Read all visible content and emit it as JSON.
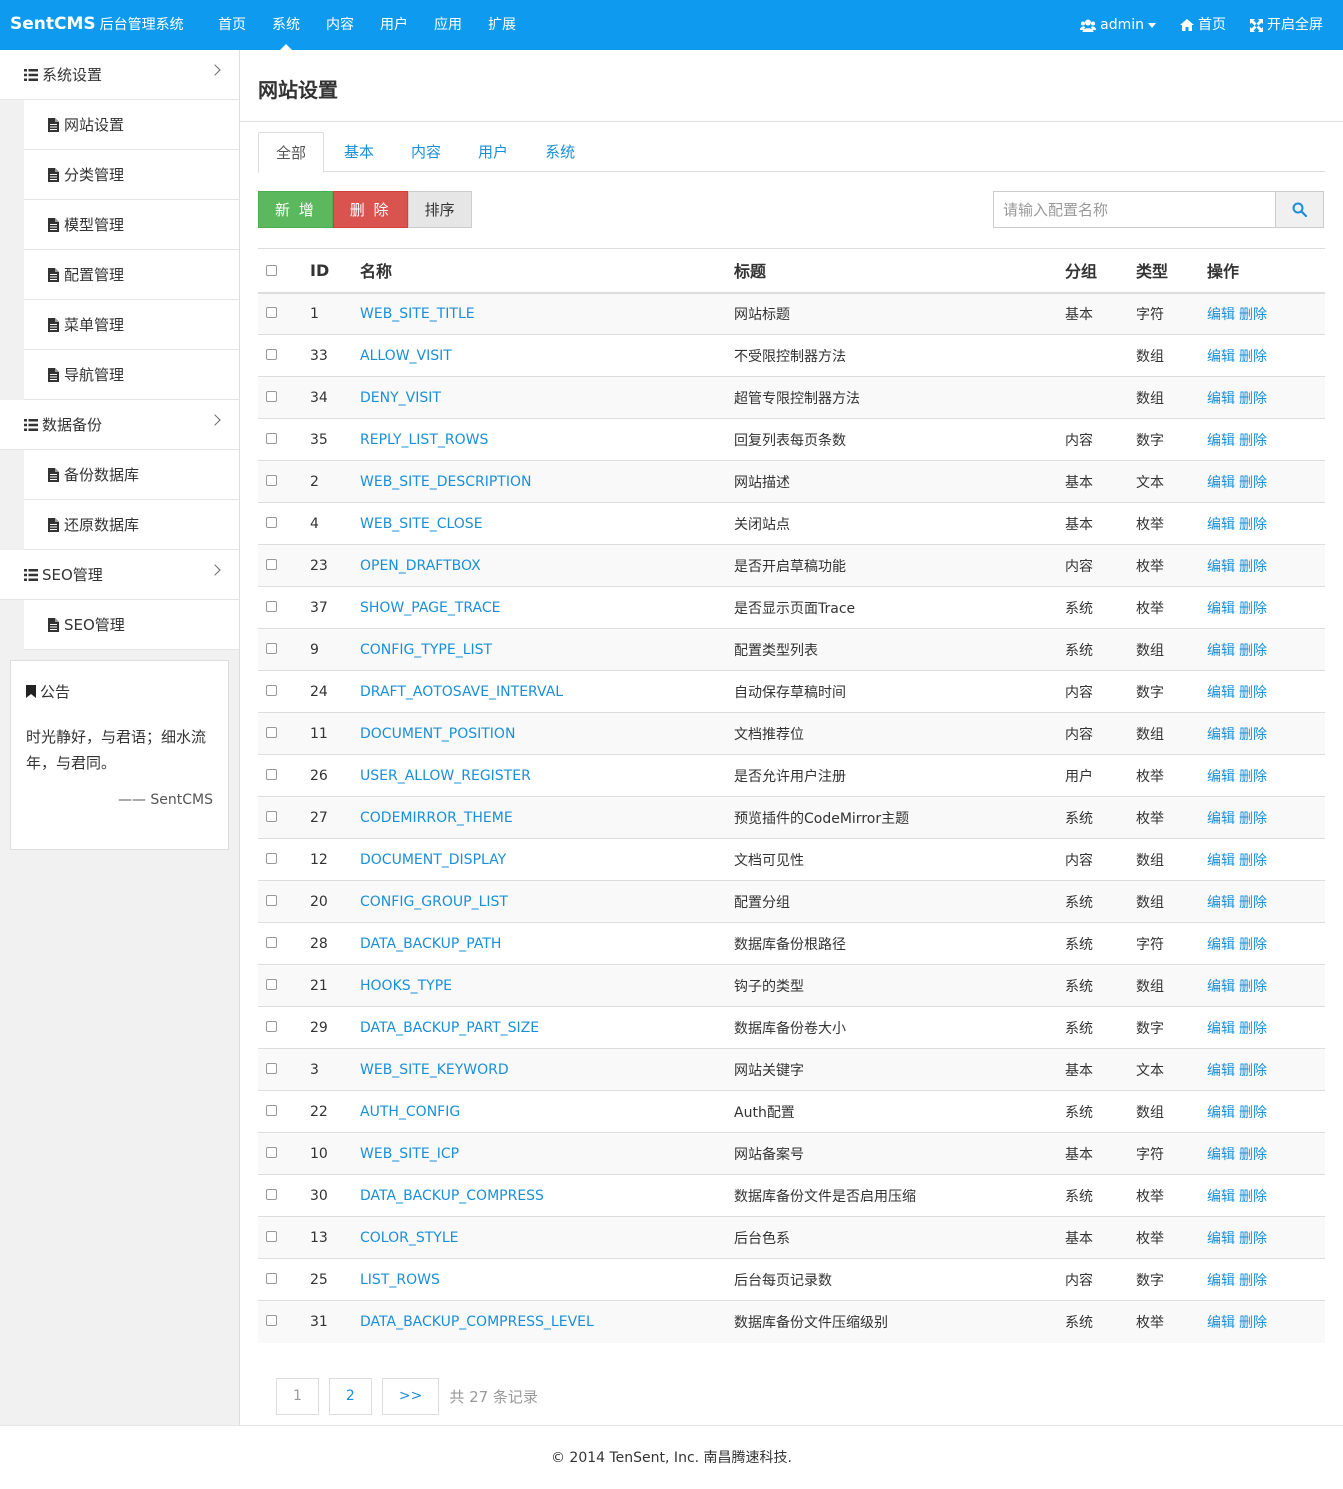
{
  "header": {
    "brand": "SentCMS",
    "brand_sub": "后台管理系统",
    "nav": [
      "首页",
      "系统",
      "内容",
      "用户",
      "应用",
      "扩展"
    ],
    "active_nav": 1,
    "user": "admin",
    "home": "首页",
    "fullscreen": "开启全屏"
  },
  "sidebar": {
    "group1": "系统设置",
    "group1_items": [
      "网站设置",
      "分类管理",
      "模型管理",
      "配置管理",
      "菜单管理",
      "导航管理"
    ],
    "group2": "数据备份",
    "group2_items": [
      "备份数据库",
      "还原数据库"
    ],
    "group3": "SEO管理",
    "group3_items": [
      "SEO管理"
    ],
    "notice_title": "公告",
    "notice_text": "时光静好，与君语；细水流年，与君同。",
    "notice_sign": "—— SentCMS"
  },
  "main": {
    "title": "网站设置",
    "tabs": [
      "全部",
      "基本",
      "内容",
      "用户",
      "系统"
    ],
    "btn_add": "新 增",
    "btn_delete": "删 除",
    "btn_sort": "排序",
    "search_placeholder": "请输入配置名称",
    "columns": [
      "ID",
      "名称",
      "标题",
      "分组",
      "类型",
      "操作"
    ],
    "edit_label": "编辑",
    "delete_label": "删除",
    "rows": [
      {
        "id": "1",
        "name": "WEB_SITE_TITLE",
        "title": "网站标题",
        "group": "基本",
        "type": "字符"
      },
      {
        "id": "33",
        "name": "ALLOW_VISIT",
        "title": "不受限控制器方法",
        "group": "",
        "type": "数组"
      },
      {
        "id": "34",
        "name": "DENY_VISIT",
        "title": "超管专限控制器方法",
        "group": "",
        "type": "数组"
      },
      {
        "id": "35",
        "name": "REPLY_LIST_ROWS",
        "title": "回复列表每页条数",
        "group": "内容",
        "type": "数字"
      },
      {
        "id": "2",
        "name": "WEB_SITE_DESCRIPTION",
        "title": "网站描述",
        "group": "基本",
        "type": "文本"
      },
      {
        "id": "4",
        "name": "WEB_SITE_CLOSE",
        "title": "关闭站点",
        "group": "基本",
        "type": "枚举"
      },
      {
        "id": "23",
        "name": "OPEN_DRAFTBOX",
        "title": "是否开启草稿功能",
        "group": "内容",
        "type": "枚举"
      },
      {
        "id": "37",
        "name": "SHOW_PAGE_TRACE",
        "title": "是否显示页面Trace",
        "group": "系统",
        "type": "枚举"
      },
      {
        "id": "9",
        "name": "CONFIG_TYPE_LIST",
        "title": "配置类型列表",
        "group": "系统",
        "type": "数组"
      },
      {
        "id": "24",
        "name": "DRAFT_AOTOSAVE_INTERVAL",
        "title": "自动保存草稿时间",
        "group": "内容",
        "type": "数字"
      },
      {
        "id": "11",
        "name": "DOCUMENT_POSITION",
        "title": "文档推荐位",
        "group": "内容",
        "type": "数组"
      },
      {
        "id": "26",
        "name": "USER_ALLOW_REGISTER",
        "title": "是否允许用户注册",
        "group": "用户",
        "type": "枚举"
      },
      {
        "id": "27",
        "name": "CODEMIRROR_THEME",
        "title": "预览插件的CodeMirror主题",
        "group": "系统",
        "type": "枚举"
      },
      {
        "id": "12",
        "name": "DOCUMENT_DISPLAY",
        "title": "文档可见性",
        "group": "内容",
        "type": "数组"
      },
      {
        "id": "20",
        "name": "CONFIG_GROUP_LIST",
        "title": "配置分组",
        "group": "系统",
        "type": "数组"
      },
      {
        "id": "28",
        "name": "DATA_BACKUP_PATH",
        "title": "数据库备份根路径",
        "group": "系统",
        "type": "字符"
      },
      {
        "id": "21",
        "name": "HOOKS_TYPE",
        "title": "钩子的类型",
        "group": "系统",
        "type": "数组"
      },
      {
        "id": "29",
        "name": "DATA_BACKUP_PART_SIZE",
        "title": "数据库备份卷大小",
        "group": "系统",
        "type": "数字"
      },
      {
        "id": "3",
        "name": "WEB_SITE_KEYWORD",
        "title": "网站关键字",
        "group": "基本",
        "type": "文本"
      },
      {
        "id": "22",
        "name": "AUTH_CONFIG",
        "title": "Auth配置",
        "group": "系统",
        "type": "数组"
      },
      {
        "id": "10",
        "name": "WEB_SITE_ICP",
        "title": "网站备案号",
        "group": "基本",
        "type": "字符"
      },
      {
        "id": "30",
        "name": "DATA_BACKUP_COMPRESS",
        "title": "数据库备份文件是否启用压缩",
        "group": "系统",
        "type": "枚举"
      },
      {
        "id": "13",
        "name": "COLOR_STYLE",
        "title": "后台色系",
        "group": "基本",
        "type": "枚举"
      },
      {
        "id": "25",
        "name": "LIST_ROWS",
        "title": "后台每页记录数",
        "group": "内容",
        "type": "数字"
      },
      {
        "id": "31",
        "name": "DATA_BACKUP_COMPRESS_LEVEL",
        "title": "数据库备份文件压缩级别",
        "group": "系统",
        "type": "枚举"
      }
    ],
    "pager": [
      "1",
      "2",
      ">>"
    ],
    "pager_total": "共 27 条记录"
  },
  "footer": "© 2014 TenSent, Inc. 南昌腾速科技.",
  "colors": {
    "header": "#0e9aef",
    "link": "#1a8fd8",
    "add": "#5cb85c",
    "delete": "#d9534f"
  }
}
